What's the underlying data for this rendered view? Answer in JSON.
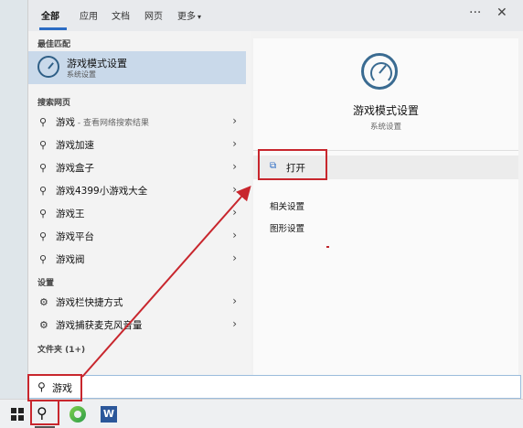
{
  "tabs": [
    {
      "label": "全部",
      "active": true
    },
    {
      "label": "应用"
    },
    {
      "label": "文档"
    },
    {
      "label": "网页"
    },
    {
      "label": "更多"
    }
  ],
  "tabbar": {
    "more_caret": "▾",
    "overflow": "···",
    "close": "✕"
  },
  "sections": {
    "best_match": "最佳匹配",
    "web": "搜索网页",
    "settings": "设置",
    "folders": "文件夹 (1+)"
  },
  "best_match": {
    "title": "游戏模式设置",
    "subtitle": "系统设置"
  },
  "web_results": [
    {
      "label": "游戏",
      "suffix": " - 查看网络搜索结果"
    },
    {
      "label": "游戏加速"
    },
    {
      "label": "游戏盒子"
    },
    {
      "label": "游戏4399小游戏大全"
    },
    {
      "label": "游戏王"
    },
    {
      "label": "游戏平台"
    },
    {
      "label": "游戏阀"
    }
  ],
  "settings_results": [
    {
      "label": "游戏栏快捷方式"
    },
    {
      "label": "游戏捕获麦克风音量"
    }
  ],
  "detail": {
    "title": "游戏模式设置",
    "subtitle": "系统设置",
    "open_label": "打开",
    "related_label": "相关设置",
    "graphics_label": "图形设置"
  },
  "search": {
    "value": "游戏"
  },
  "icons": {
    "search": "⚲",
    "gear": "⚙",
    "chevron": "›",
    "open": "⧉"
  },
  "taskbar": {
    "word_letter": "W"
  },
  "colors": {
    "annotation_red": "#c8262d",
    "accent_blue": "#2b6cc4"
  }
}
